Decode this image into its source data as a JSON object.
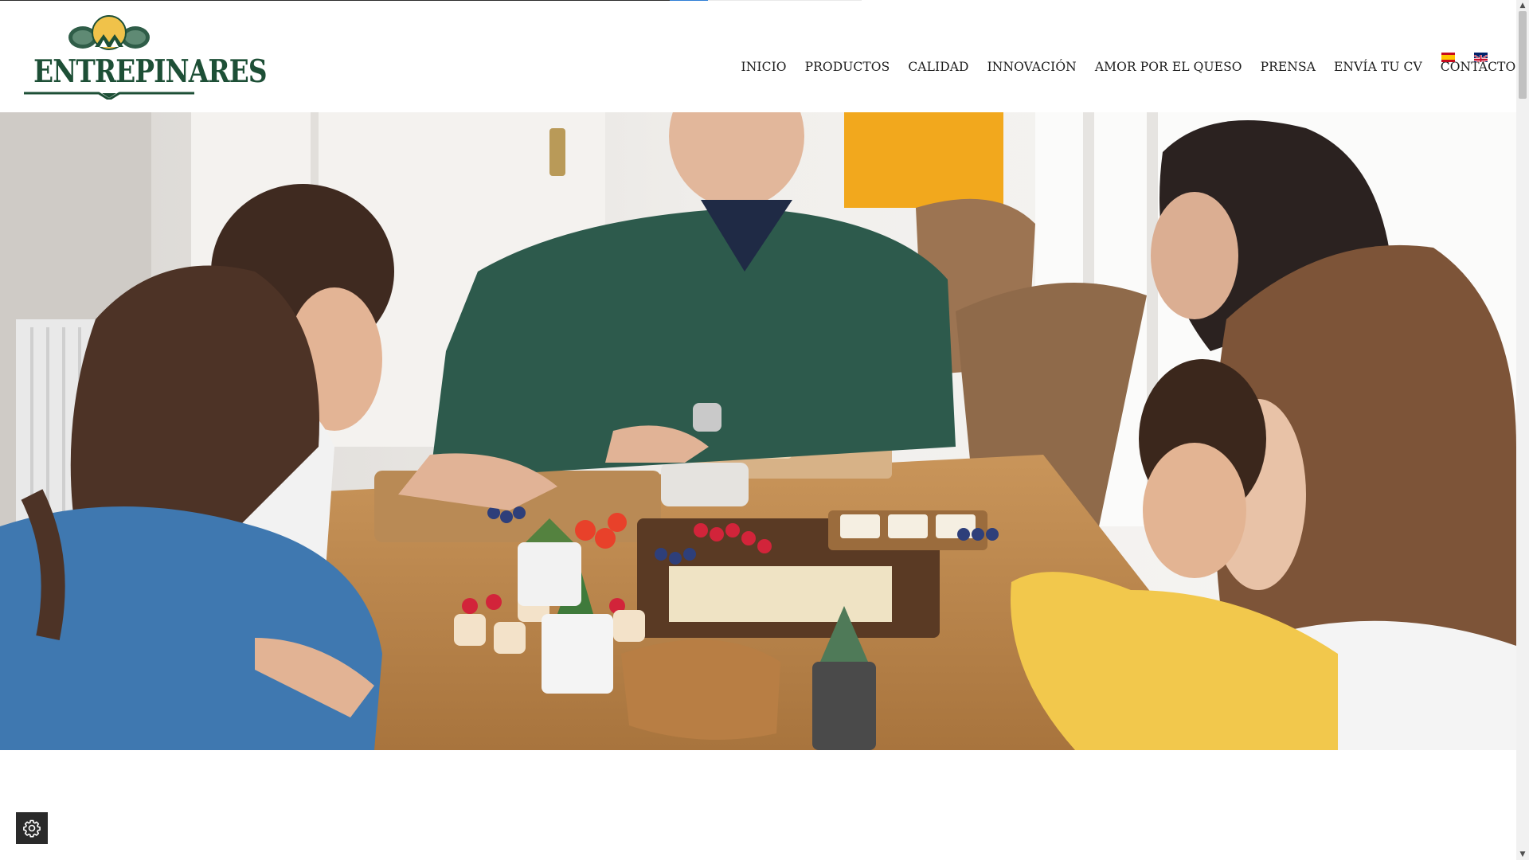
{
  "brand": {
    "logo_text": "ENTREPINARES",
    "primary_color": "#1d4f36",
    "accent_color": "#e8b84b"
  },
  "nav": {
    "items": [
      {
        "label": "INICIO"
      },
      {
        "label": "PRODUCTOS"
      },
      {
        "label": "CALIDAD"
      },
      {
        "label": "INNOVACIÓN"
      },
      {
        "label": "AMOR POR EL QUESO"
      },
      {
        "label": "PRENSA"
      },
      {
        "label": "ENVÍA TU CV"
      },
      {
        "label": "CONTACTO"
      }
    ]
  },
  "languages": [
    {
      "code": "es",
      "icon": "spain-flag-icon"
    },
    {
      "code": "en",
      "icon": "uk-flag-icon"
    }
  ],
  "hero": {
    "icon": "family-meal-photo"
  },
  "cookie_settings": {
    "icon": "gear-icon"
  },
  "scrollbar": {
    "up_icon": "▲",
    "down_icon": "▼"
  }
}
